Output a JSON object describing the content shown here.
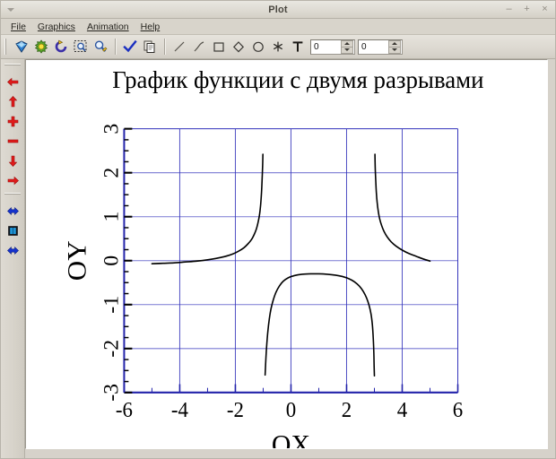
{
  "window": {
    "title": "Plot",
    "buttons": [
      {
        "name": "minimize-button",
        "glyph": "–"
      },
      {
        "name": "maximize-button",
        "glyph": "+"
      },
      {
        "name": "close-button",
        "glyph": "×"
      }
    ]
  },
  "menubar": {
    "items": [
      {
        "label": "File",
        "accel": "F"
      },
      {
        "label": "Graphics",
        "accel": "G"
      },
      {
        "label": "Animation",
        "accel": "A"
      },
      {
        "label": "Help",
        "accel": "H"
      }
    ]
  },
  "toolbar": {
    "buttons": [
      {
        "name": "diamond-gem-icon",
        "tip": "Object"
      },
      {
        "name": "green-gear-icon",
        "tip": "Settings"
      },
      {
        "name": "refresh-circle-icon",
        "tip": "Refresh"
      },
      {
        "name": "zoom-select-icon",
        "tip": "Zoom to selection"
      },
      {
        "name": "magnifier-icon",
        "tip": "Zoom"
      },
      {
        "name": "check-icon",
        "tip": "Apply"
      },
      {
        "name": "copy-icon",
        "tip": "Copy"
      },
      {
        "name": "line-icon",
        "tip": "Line"
      },
      {
        "name": "curve-icon",
        "tip": "Curve"
      },
      {
        "name": "rectangle-icon",
        "tip": "Rectangle"
      },
      {
        "name": "diamond-icon",
        "tip": "Diamond"
      },
      {
        "name": "ellipse-icon",
        "tip": "Ellipse"
      },
      {
        "name": "asterisk-icon",
        "tip": "Marker"
      },
      {
        "name": "text-icon",
        "tip": "Text"
      }
    ],
    "spin_x": "0",
    "spin_y": "0"
  },
  "sidebar": {
    "buttons": [
      {
        "name": "arrow-left-icon",
        "color": "#e02020"
      },
      {
        "name": "arrow-up-icon",
        "color": "#e02020"
      },
      {
        "name": "plus-icon",
        "color": "#e02020"
      },
      {
        "name": "minus-icon",
        "color": "#e02020"
      },
      {
        "name": "arrow-down-icon",
        "color": "#e02020"
      },
      {
        "name": "arrow-right-icon",
        "color": "#e02020"
      },
      {
        "name": "arrow-right-blue-icon",
        "color": "#1533cf"
      },
      {
        "name": "page-blue-icon",
        "color": "#1a6fd4"
      },
      {
        "name": "arrow-left-blue-icon",
        "color": "#1533cf"
      }
    ]
  },
  "chart_data": {
    "type": "line",
    "title": "График функции с двумя разрывами",
    "xlabel": "OX",
    "ylabel": "OY",
    "xlim": [
      -6,
      6
    ],
    "ylim": [
      -3,
      3
    ],
    "xticks": [
      -6,
      -4,
      -2,
      0,
      2,
      4,
      6
    ],
    "yticks": [
      -3,
      -2,
      -1,
      0,
      1,
      2,
      3
    ],
    "xtick_labels": [
      "-6",
      "-4",
      "-2",
      "0",
      "2",
      "4",
      "6"
    ],
    "ytick_labels": [
      "-3",
      "-2",
      "-1",
      "0",
      "1",
      "2",
      "3"
    ],
    "minor_tick_step_x": 1,
    "minor_tick_step_y": 0.25,
    "grid": true,
    "grid_color": "#3333bb",
    "axis_color": "#2222aa",
    "line_color": "#000000",
    "line_width": 1.6,
    "asymptotes": [
      -1,
      3
    ],
    "series": [
      {
        "name": "branch-left",
        "points": [
          [
            -5.0,
            -0.07
          ],
          [
            -4.6,
            -0.06
          ],
          [
            -4.2,
            -0.05
          ],
          [
            -3.8,
            -0.03
          ],
          [
            -3.4,
            -0.01
          ],
          [
            -3.0,
            0.02
          ],
          [
            -2.7,
            0.05
          ],
          [
            -2.4,
            0.09
          ],
          [
            -2.1,
            0.15
          ],
          [
            -1.9,
            0.21
          ],
          [
            -1.7,
            0.29
          ],
          [
            -1.55,
            0.38
          ],
          [
            -1.42,
            0.48
          ],
          [
            -1.32,
            0.6
          ],
          [
            -1.24,
            0.73
          ],
          [
            -1.18,
            0.88
          ],
          [
            -1.13,
            1.05
          ],
          [
            -1.09,
            1.28
          ],
          [
            -1.06,
            1.55
          ],
          [
            -1.04,
            1.82
          ],
          [
            -1.02,
            2.15
          ],
          [
            -1.01,
            2.42
          ]
        ]
      },
      {
        "name": "branch-middle",
        "points": [
          [
            -0.93,
            -2.6
          ],
          [
            -0.9,
            -2.2
          ],
          [
            -0.87,
            -1.9
          ],
          [
            -0.83,
            -1.6
          ],
          [
            -0.78,
            -1.33
          ],
          [
            -0.72,
            -1.1
          ],
          [
            -0.64,
            -0.9
          ],
          [
            -0.54,
            -0.72
          ],
          [
            -0.42,
            -0.58
          ],
          [
            -0.28,
            -0.47
          ],
          [
            -0.1,
            -0.39
          ],
          [
            0.12,
            -0.34
          ],
          [
            0.4,
            -0.31
          ],
          [
            0.7,
            -0.3
          ],
          [
            1.0,
            -0.3
          ],
          [
            1.3,
            -0.31
          ],
          [
            1.6,
            -0.33
          ],
          [
            1.85,
            -0.36
          ],
          [
            2.08,
            -0.41
          ],
          [
            2.28,
            -0.48
          ],
          [
            2.46,
            -0.58
          ],
          [
            2.6,
            -0.7
          ],
          [
            2.72,
            -0.85
          ],
          [
            2.81,
            -1.02
          ],
          [
            2.88,
            -1.22
          ],
          [
            2.93,
            -1.48
          ],
          [
            2.96,
            -1.78
          ],
          [
            2.98,
            -2.1
          ],
          [
            2.99,
            -2.4
          ],
          [
            3.0,
            -2.62
          ]
        ]
      },
      {
        "name": "branch-right",
        "points": [
          [
            3.02,
            2.42
          ],
          [
            3.03,
            2.1
          ],
          [
            3.05,
            1.8
          ],
          [
            3.07,
            1.55
          ],
          [
            3.1,
            1.32
          ],
          [
            3.14,
            1.12
          ],
          [
            3.19,
            0.95
          ],
          [
            3.26,
            0.8
          ],
          [
            3.35,
            0.66
          ],
          [
            3.46,
            0.54
          ],
          [
            3.6,
            0.43
          ],
          [
            3.78,
            0.33
          ],
          [
            4.0,
            0.24
          ],
          [
            4.25,
            0.16
          ],
          [
            4.5,
            0.1
          ],
          [
            4.75,
            0.04
          ],
          [
            5.0,
            -0.01
          ]
        ]
      }
    ]
  }
}
